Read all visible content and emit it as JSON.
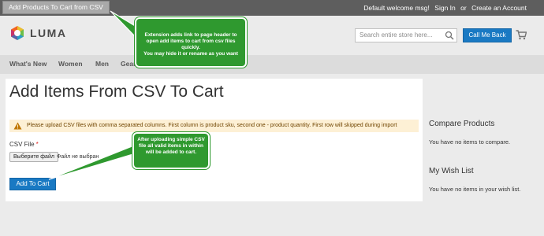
{
  "header": {
    "top_link": "Add Products To Cart from CSV",
    "welcome": "Default welcome msg!",
    "sign_in": "Sign In",
    "or": "or",
    "create_account": "Create an Account"
  },
  "logo": {
    "text": "LUMA"
  },
  "search": {
    "placeholder": "Search entire store here..."
  },
  "call_me_back": "Call Me Back",
  "nav": {
    "items": [
      "What's New",
      "Women",
      "Men",
      "Gear"
    ]
  },
  "page": {
    "title": "Add Items From CSV To Cart",
    "notice": "Please upload CSV files with comma separated columns. First column is product sku, second one - product quantity. First row will skipped during import",
    "file_label": "CSV File",
    "required_mark": "*",
    "file_button": "Выберите файл",
    "file_status": "Файл не выбран",
    "add_button": "Add To Cart"
  },
  "sidebar": {
    "compare_title": "Compare Products",
    "compare_text": "You have no items to compare.",
    "wishlist_title": "My Wish List",
    "wishlist_text": "You have no items in your wish list."
  },
  "callouts": {
    "header_note": "Extension adds link to page header to open add items to cart from csv files quickly.\nYou may hide it or rename as you want",
    "upload_note": "After uploading simple CSV file all valid items in within will be added to cart."
  },
  "colors": {
    "top_bar": "#5e5e5e",
    "accent_blue": "#1979c3",
    "callout_green": "#2f992f",
    "notice_bg": "#fdf0d5",
    "required_red": "#e02b27"
  }
}
